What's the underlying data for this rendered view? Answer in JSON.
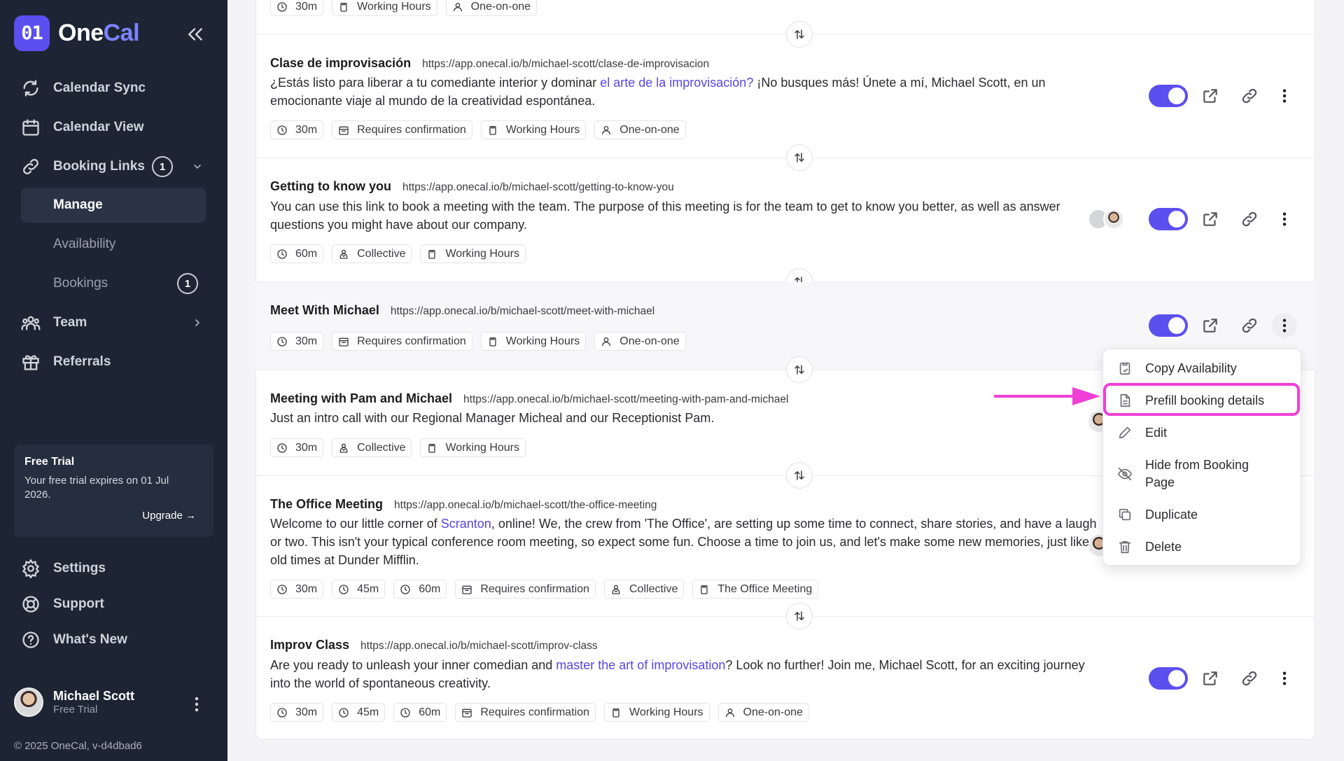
{
  "app": {
    "logo_mark": "01",
    "logo_one": "One",
    "logo_cal": "Cal"
  },
  "sidebar": {
    "nav": [
      {
        "label": "Calendar Sync",
        "icon": "sync-icon"
      },
      {
        "label": "Calendar View",
        "icon": "calendar-icon"
      },
      {
        "label": "Booking Links",
        "icon": "link-icon",
        "badge": "1"
      },
      {
        "label": "Team",
        "icon": "team-icon"
      },
      {
        "label": "Referrals",
        "icon": "gift-icon"
      }
    ],
    "sub": [
      {
        "label": "Manage"
      },
      {
        "label": "Availability"
      },
      {
        "label": "Bookings",
        "badge": "1"
      }
    ],
    "bottom": [
      {
        "label": "Settings",
        "icon": "gear-icon"
      },
      {
        "label": "Support",
        "icon": "lifebuoy-icon"
      },
      {
        "label": "What's New",
        "icon": "help-icon"
      }
    ],
    "trial": {
      "title": "Free Trial",
      "text": "Your free trial expires on 01 Jul 2026.",
      "upgrade": "Upgrade →"
    },
    "user": {
      "name": "Michael Scott",
      "plan": "Free Trial"
    },
    "footer": "© 2025 OneCal, v-d4dbad6"
  },
  "links": [
    {
      "tags": [
        "30m",
        "Working Hours",
        "One-on-one"
      ]
    },
    {
      "title": "Clase de improvisación",
      "url": "https://app.onecal.io/b/michael-scott/clase-de-improvisacion",
      "desc_a": "¿Estás listo para liberar a tu comediante interior y dominar ",
      "desc_link": "el arte de la improvisación?",
      "desc_b": " ¡No busques más! Únete a mí, Michael Scott, en un emocionante viaje al mundo de la creatividad espontánea.",
      "tags": [
        "30m",
        "Requires confirmation",
        "Working Hours",
        "One-on-one"
      ]
    },
    {
      "title": "Getting to know you",
      "url": "https://app.onecal.io/b/michael-scott/getting-to-know-you",
      "desc": "You can use this link to book a meeting with the team. The purpose of this meeting is for the team to get to know you better, as well as answer questions you might have about our company.",
      "tags": [
        "60m",
        "Collective",
        "Working Hours"
      ]
    },
    {
      "title": "Meet With Michael",
      "url": "https://app.onecal.io/b/michael-scott/meet-with-michael",
      "tags": [
        "30m",
        "Requires confirmation",
        "Working Hours",
        "One-on-one"
      ]
    },
    {
      "title": "Meeting with Pam and Michael",
      "url": "https://app.onecal.io/b/michael-scott/meeting-with-pam-and-michael",
      "desc": "Just an intro call with our Regional Manager Micheal and our Receptionist Pam.",
      "tags": [
        "30m",
        "Collective",
        "Working Hours"
      ]
    },
    {
      "title": "The Office Meeting",
      "url": "https://app.onecal.io/b/michael-scott/the-office-meeting",
      "desc_a": "Welcome to our little corner of ",
      "desc_link": "Scranton",
      "desc_b": ", online! We, the crew from 'The Office', are setting up some time to connect, share stories, and have a laugh or two. This isn't your typical conference room meeting, so expect some fun. Choose a time to join us, and let's make some new memories, just like old times at Dunder Mifflin.",
      "tags": [
        "30m",
        "45m",
        "60m",
        "Requires confirmation",
        "Collective",
        "The Office Meeting"
      ]
    },
    {
      "title": "Improv Class",
      "url": "https://app.onecal.io/b/michael-scott/improv-class",
      "desc_a": "Are you ready to unleash your inner comedian and ",
      "desc_link": "master the art of improvisation",
      "desc_b": "? Look no further! Join me, Michael Scott, for an exciting journey into the world of spontaneous creativity.",
      "tags": [
        "30m",
        "45m",
        "60m",
        "Requires confirmation",
        "Working Hours",
        "One-on-one"
      ]
    }
  ],
  "menu": [
    {
      "label": "Copy Availability",
      "icon": "copy-availability-icon"
    },
    {
      "label": "Prefill booking details",
      "icon": "document-icon"
    },
    {
      "label": "Edit",
      "icon": "pencil-icon"
    },
    {
      "label": "Hide from Booking Page",
      "icon": "eye-off-icon"
    },
    {
      "label": "Duplicate",
      "icon": "duplicate-icon"
    },
    {
      "label": "Delete",
      "icon": "trash-icon"
    }
  ],
  "colors": {
    "accent": "#5b4ff0",
    "sidebar": "#1d2534",
    "highlight": "#f03fd6",
    "link": "#5546e8"
  }
}
